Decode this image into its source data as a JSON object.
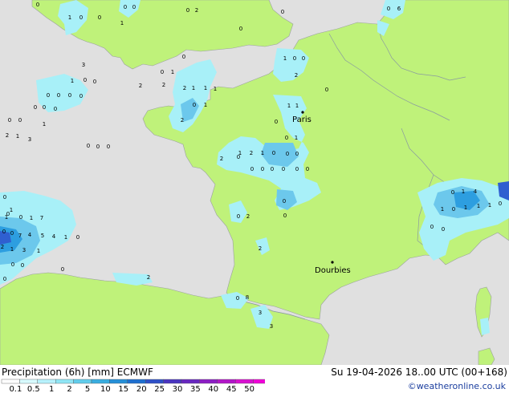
{
  "map": {
    "cities": [
      {
        "name": "Paris"
      },
      {
        "name": "Dourbies"
      }
    ],
    "precip_labels": [
      "0",
      "1",
      "0",
      "0",
      "1",
      "0",
      "0",
      "0",
      "2",
      "0",
      "0",
      "0",
      "6",
      "0",
      "1",
      "1",
      "3",
      "1",
      "0",
      "0",
      "0",
      "0",
      "0",
      "0",
      "0",
      "0",
      "0",
      "0",
      "0",
      "1",
      "2",
      "1",
      "3",
      "0",
      "0",
      "0",
      "0",
      "1",
      "0",
      "2",
      "2",
      "2",
      "1",
      "1",
      "1",
      "0",
      "1",
      "2",
      "1",
      "0",
      "0",
      "2",
      "1",
      "1",
      "0",
      "0",
      "1",
      "1",
      "2",
      "1",
      "0",
      "0",
      "0",
      "0",
      "0",
      "0",
      "0",
      "0",
      "0",
      "0",
      "0",
      "0",
      "0",
      "0",
      "2",
      "2",
      "2",
      "0",
      "0",
      "1",
      "7",
      "5",
      "4",
      "1",
      "0",
      "0",
      "0",
      "7",
      "4",
      "2",
      "1",
      "3",
      "1",
      "0",
      "0",
      "0",
      "0",
      "2",
      "8",
      "0",
      "3",
      "3",
      "0",
      "1",
      "4",
      "1",
      "0",
      "1",
      "1",
      "1",
      "0",
      "0",
      "0"
    ],
    "colors": {
      "sea": "#e0e0e0",
      "land": "#bff27a",
      "precip_light": "#a8f0f8",
      "precip_medium": "#6cc8ec",
      "precip_heavy": "#2d9ee0",
      "precip_very_heavy": "#2f5fd0"
    }
  },
  "footer": {
    "title": "Precipitation (6h) [mm] ECMWF",
    "valid": "Su 19-04-2026 18..00 UTC (00+168)",
    "credit": "©weatheronline.co.uk",
    "scale_ticks": [
      "0.1",
      "0.5",
      "1",
      "2",
      "5",
      "10",
      "15",
      "20",
      "25",
      "30",
      "35",
      "40",
      "45",
      "50"
    ],
    "scale_colors": [
      "#ffffff",
      "#d8fbff",
      "#b8f2fc",
      "#90e6f6",
      "#62cdec",
      "#3aaee0",
      "#2690d8",
      "#1f70d0",
      "#2f50c8",
      "#4a35c0",
      "#6828c0",
      "#8c1ec4",
      "#b216c8",
      "#d810d0",
      "#f000d8"
    ]
  }
}
